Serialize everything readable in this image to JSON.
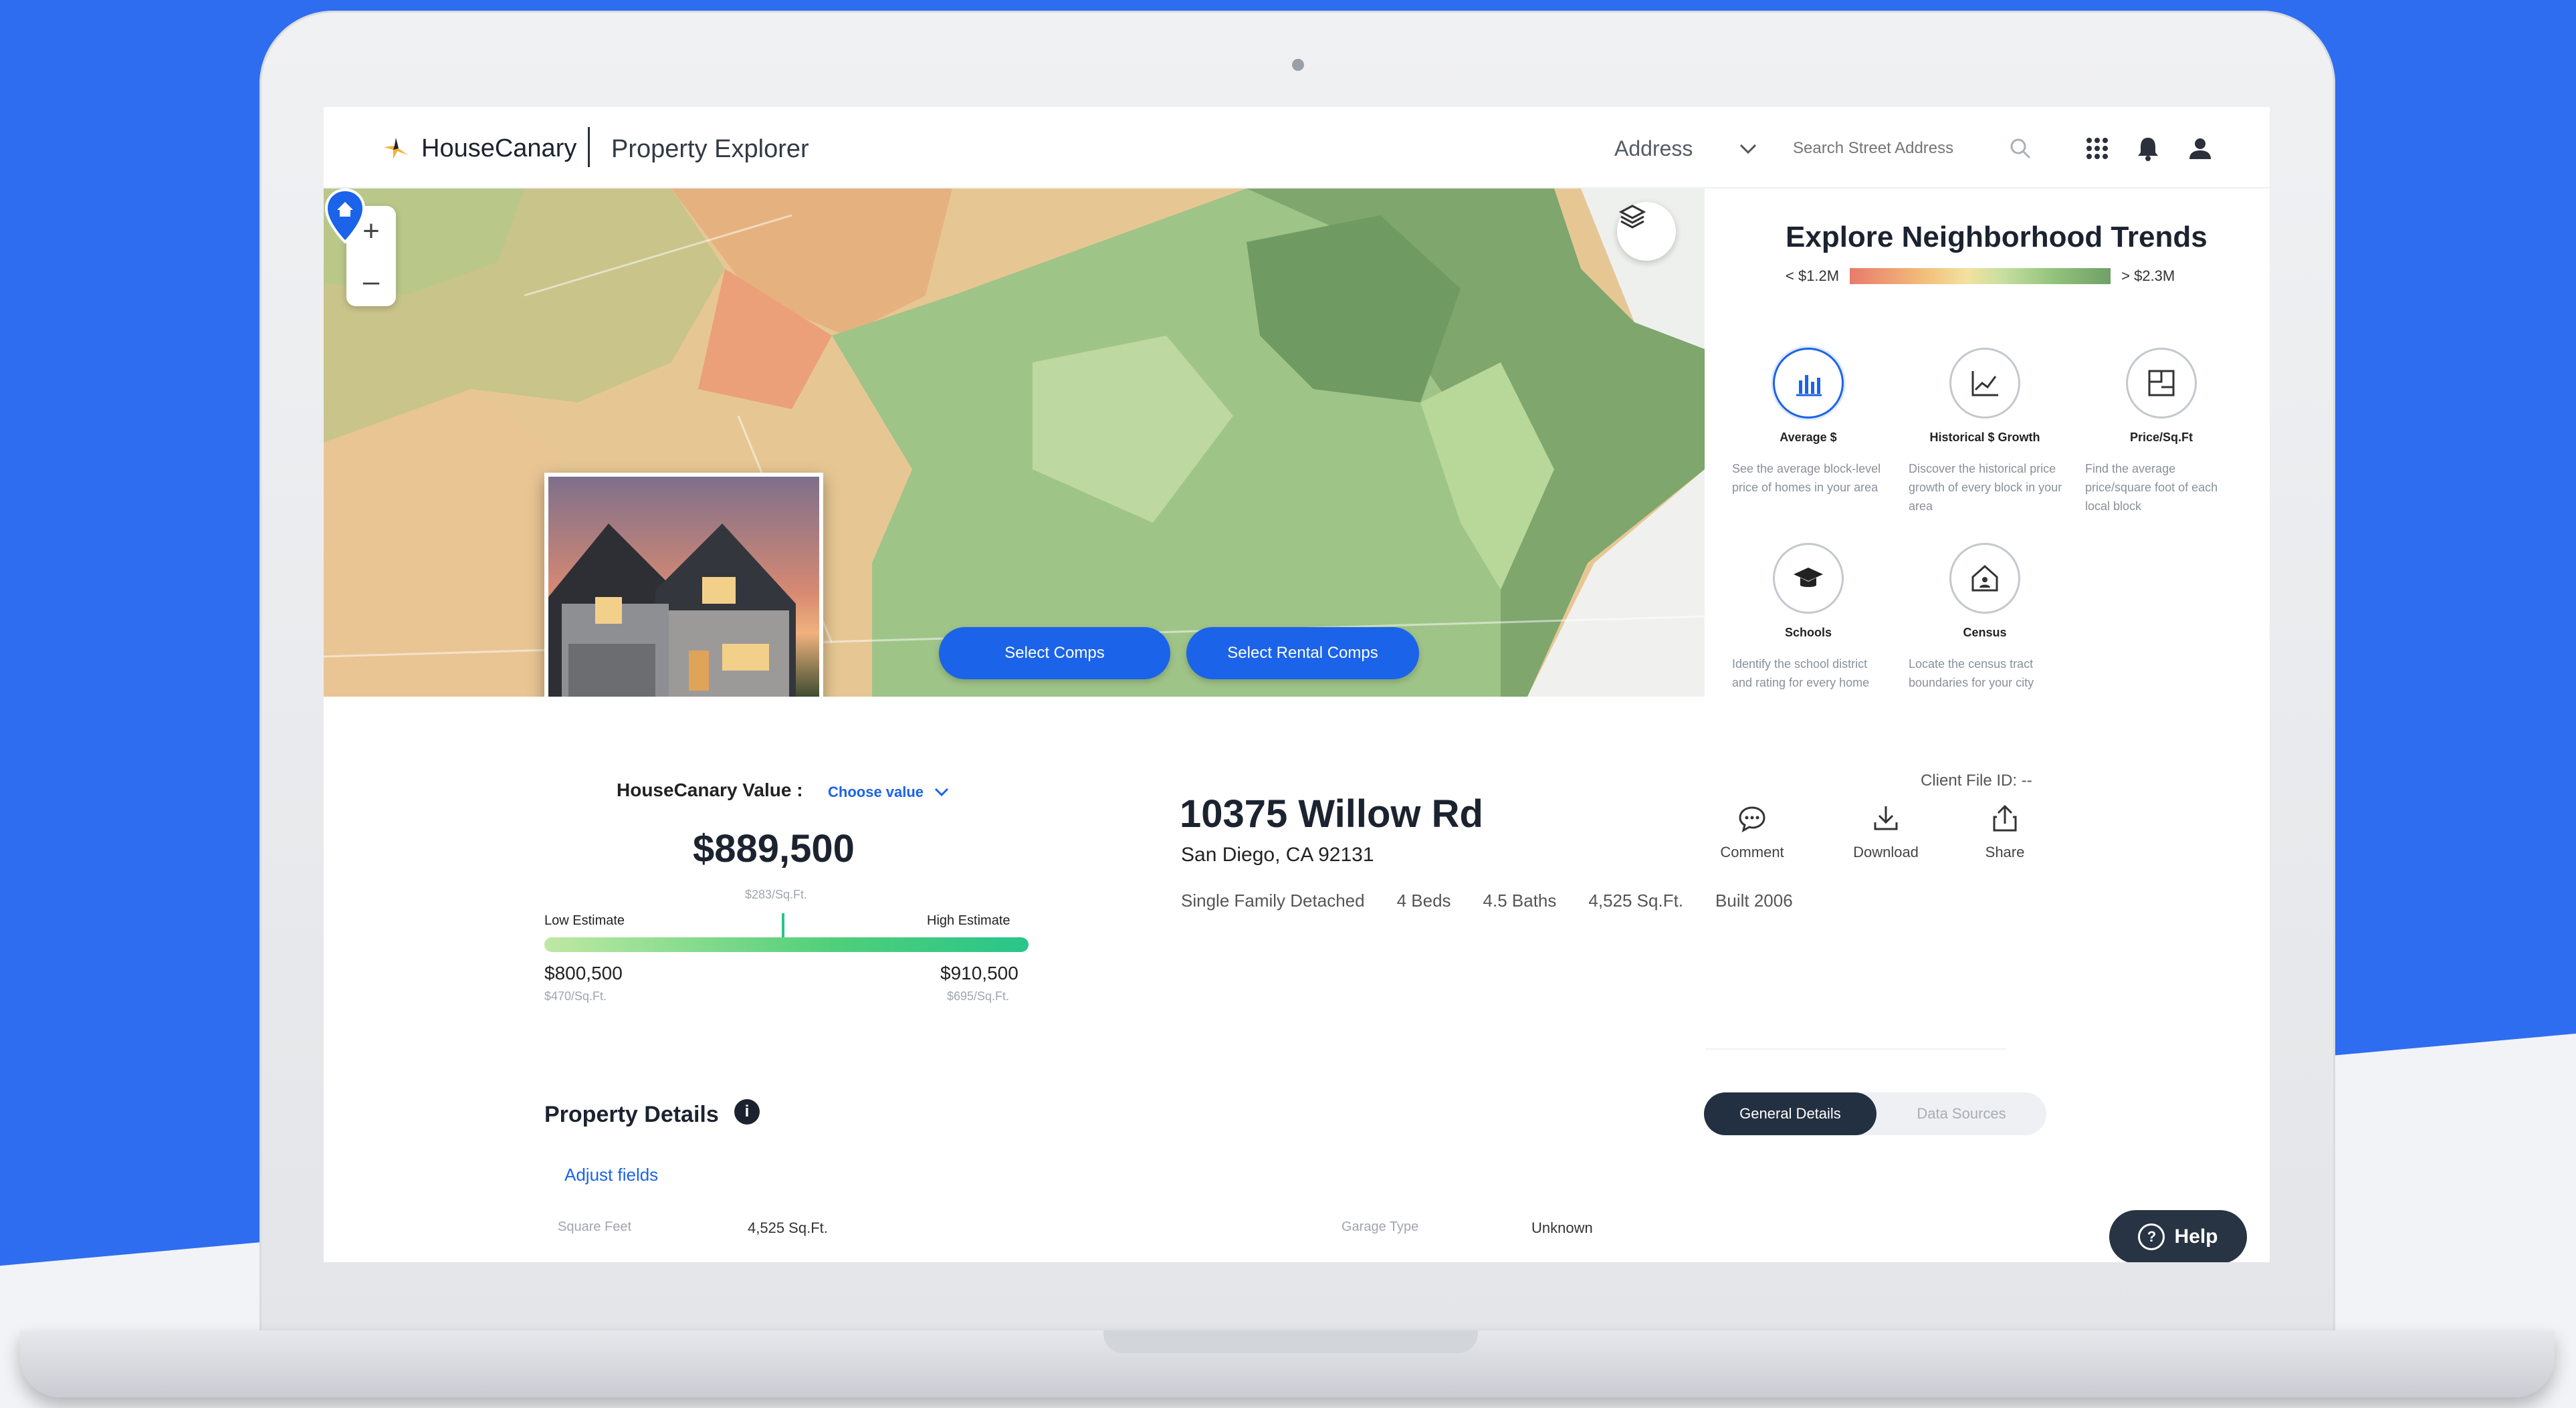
{
  "header": {
    "brand": "HouseCanary",
    "app_title": "Property Explorer",
    "search_type": "Address",
    "search_placeholder": "Search Street Address"
  },
  "map": {
    "buttons": {
      "select_comps": "Select Comps",
      "select_rental_comps": "Select Rental Comps"
    },
    "zoom_in": "+",
    "zoom_out": "–"
  },
  "trends": {
    "title": "Explore Neighborhood Trends",
    "legend_min": "< $1.2M",
    "legend_max": "> $2.3M",
    "items": [
      {
        "label": "Average $",
        "desc": "See the average block-level price of homes in your area",
        "icon": "bar-chart-icon"
      },
      {
        "label": "Historical $ Growth",
        "desc": "Discover the historical price growth of every block in your area",
        "icon": "line-chart-icon"
      },
      {
        "label": "Price/Sq.Ft",
        "desc": "Find the average price/square foot of each local block",
        "icon": "floorplan-icon"
      },
      {
        "label": "Schools",
        "desc": "Identify the school district and rating for every home",
        "icon": "graduation-cap-icon"
      },
      {
        "label": "Census",
        "desc": "Locate the census tract boundaries for your city",
        "icon": "census-house-icon"
      }
    ]
  },
  "valuation": {
    "label": "HouseCanary Value :",
    "choose": "Choose value",
    "value": "$889,500",
    "psf": "$283/Sq.Ft.",
    "low_label": "Low Estimate",
    "high_label": "High Estimate",
    "low_value": "$800,500",
    "high_value": "$910,500",
    "low_psf": "$470/Sq.Ft.",
    "high_psf": "$695/Sq.Ft.",
    "estimate_position": 0.49
  },
  "property": {
    "client_file": "Client File ID: --",
    "address": "10375 Willow Rd",
    "city": "San Diego, CA 92131",
    "attributes": [
      "Single Family Detached",
      "4 Beds",
      "4.5 Baths",
      "4,525 Sq.Ft.",
      "Built 2006"
    ],
    "actions": {
      "comment": "Comment",
      "download": "Download",
      "share": "Share"
    }
  },
  "details": {
    "title": "Property Details",
    "adjust": "Adjust fields",
    "tab_general": "General Details",
    "tab_sources": "Data Sources",
    "rows": [
      {
        "label": "Square Feet",
        "value": "4,525 Sq.Ft."
      },
      {
        "label": "Garage Type",
        "value": "Unknown"
      }
    ]
  },
  "help": "Help",
  "colors": {
    "accent": "#1b63e8",
    "dark": "#233041"
  }
}
